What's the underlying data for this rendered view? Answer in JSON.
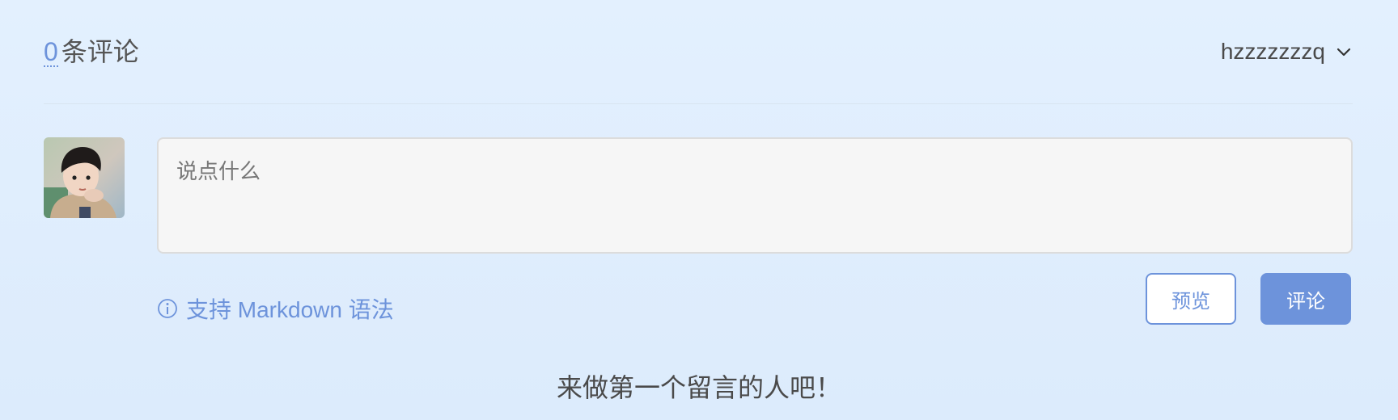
{
  "header": {
    "comment_count": "0",
    "comment_count_suffix": "条评论",
    "username": "hzzzzzzzq",
    "username_icon": "chevron-down-icon"
  },
  "composer": {
    "avatar_icon": "user-avatar",
    "placeholder": "说点什么",
    "value": "",
    "markdown_hint_icon": "info-circle-icon",
    "markdown_hint": "支持 Markdown 语法",
    "preview_label": "预览",
    "submit_label": "评论"
  },
  "empty_state": {
    "message": "来做第一个留言的人吧！"
  },
  "colors": {
    "accent": "#6d93db",
    "background": "#e3f0fe",
    "input_background": "#f6f6f6",
    "text": "#4a4a4a"
  }
}
